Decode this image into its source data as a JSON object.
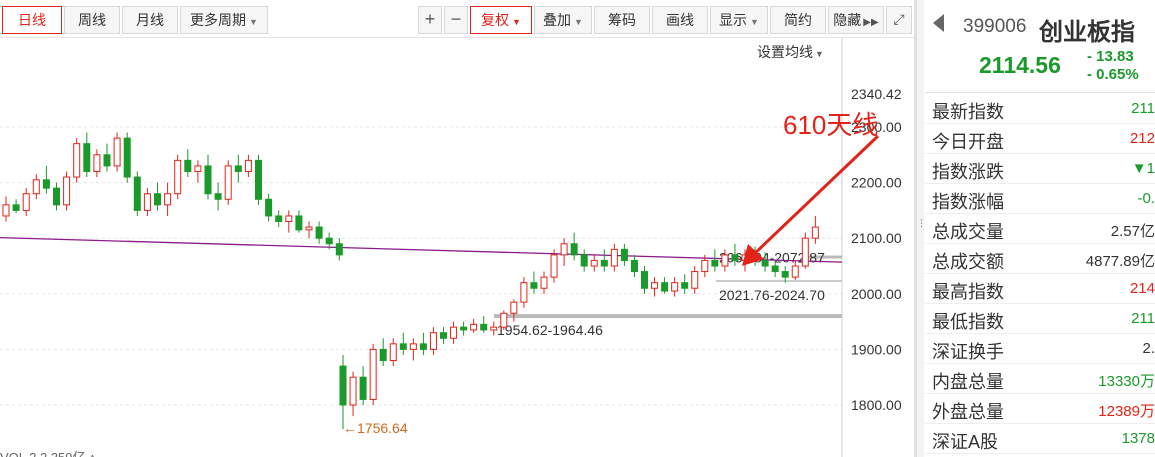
{
  "toolbar": {
    "periods": [
      "日线",
      "周线",
      "月线",
      "更多周期"
    ],
    "zoom_in": "+",
    "zoom_out": "−",
    "adjust": "复权",
    "overlay": "叠加",
    "chips": "筹码",
    "draw": "画线",
    "display": "显示",
    "simple": "简约",
    "hide": "隐藏",
    "expand_icon": "double-chevron-right-icon",
    "fullscreen_icon": "fullscreen-icon"
  },
  "chart": {
    "ma_setting": "设置均线",
    "annotation": "610天线",
    "y_axis": {
      "top_value": "2340.42",
      "ticks": [
        "2300.00",
        "2200.00",
        "2100.00",
        "2000.00",
        "1900.00",
        "1800.00"
      ]
    },
    "low_marker": "←1756.64",
    "ranges": [
      {
        "label": "1954.62-1964.46"
      },
      {
        "label": "2021.76-2024.70"
      },
      {
        "label": "2061.84-2072.87"
      }
    ],
    "bottom_text": "VOL 2 2 359亿 ↑"
  },
  "chart_data": {
    "type": "candlestick",
    "ylim": [
      1740,
      2360
    ],
    "annotations": [
      "610天线",
      "1756.64",
      "1954.62-1964.46",
      "2021.76-2024.70",
      "2061.84-2072.87"
    ],
    "candles": [
      [
        2140,
        2175,
        2130,
        2160
      ],
      [
        2160,
        2170,
        2145,
        2150
      ],
      [
        2150,
        2190,
        2140,
        2180
      ],
      [
        2180,
        2215,
        2170,
        2205
      ],
      [
        2205,
        2230,
        2180,
        2190
      ],
      [
        2190,
        2200,
        2150,
        2160
      ],
      [
        2160,
        2220,
        2150,
        2210
      ],
      [
        2210,
        2280,
        2200,
        2270
      ],
      [
        2270,
        2290,
        2210,
        2220
      ],
      [
        2220,
        2260,
        2210,
        2250
      ],
      [
        2250,
        2270,
        2220,
        2230
      ],
      [
        2230,
        2290,
        2220,
        2280
      ],
      [
        2280,
        2290,
        2200,
        2210
      ],
      [
        2210,
        2220,
        2140,
        2150
      ],
      [
        2150,
        2190,
        2140,
        2180
      ],
      [
        2180,
        2200,
        2150,
        2160
      ],
      [
        2160,
        2200,
        2140,
        2180
      ],
      [
        2180,
        2250,
        2170,
        2240
      ],
      [
        2240,
        2260,
        2210,
        2220
      ],
      [
        2220,
        2240,
        2200,
        2230
      ],
      [
        2230,
        2250,
        2170,
        2180
      ],
      [
        2180,
        2200,
        2150,
        2170
      ],
      [
        2170,
        2240,
        2160,
        2230
      ],
      [
        2230,
        2250,
        2200,
        2220
      ],
      [
        2220,
        2250,
        2210,
        2240
      ],
      [
        2240,
        2250,
        2160,
        2170
      ],
      [
        2170,
        2180,
        2130,
        2140
      ],
      [
        2140,
        2150,
        2120,
        2130
      ],
      [
        2130,
        2150,
        2110,
        2140
      ],
      [
        2140,
        2150,
        2110,
        2115
      ],
      [
        2115,
        2130,
        2100,
        2120
      ],
      [
        2120,
        2130,
        2090,
        2100
      ],
      [
        2100,
        2110,
        2080,
        2090
      ],
      [
        2090,
        2100,
        2060,
        2070
      ],
      [
        1870,
        1890,
        1756.64,
        1800
      ],
      [
        1800,
        1860,
        1780,
        1850
      ],
      [
        1850,
        1870,
        1800,
        1810
      ],
      [
        1810,
        1910,
        1800,
        1900
      ],
      [
        1900,
        1920,
        1870,
        1880
      ],
      [
        1880,
        1920,
        1870,
        1910
      ],
      [
        1910,
        1930,
        1890,
        1900
      ],
      [
        1900,
        1920,
        1880,
        1910
      ],
      [
        1910,
        1930,
        1890,
        1900
      ],
      [
        1900,
        1940,
        1890,
        1930
      ],
      [
        1930,
        1940,
        1910,
        1920
      ],
      [
        1920,
        1950,
        1910,
        1940
      ],
      [
        1940,
        1950,
        1925,
        1935
      ],
      [
        1935,
        1955,
        1930,
        1945
      ],
      [
        1945,
        1960,
        1930,
        1935
      ],
      [
        1935,
        1950,
        1925,
        1940
      ],
      [
        1940,
        1970,
        1935,
        1965
      ],
      [
        1965,
        1990,
        1950,
        1985
      ],
      [
        1985,
        2030,
        1975,
        2020
      ],
      [
        2020,
        2040,
        2000,
        2010
      ],
      [
        2010,
        2040,
        2000,
        2030
      ],
      [
        2030,
        2080,
        2020,
        2070
      ],
      [
        2070,
        2100,
        2050,
        2090
      ],
      [
        2090,
        2110,
        2060,
        2070
      ],
      [
        2070,
        2080,
        2040,
        2050
      ],
      [
        2050,
        2070,
        2040,
        2060
      ],
      [
        2060,
        2080,
        2040,
        2050
      ],
      [
        2050,
        2090,
        2040,
        2080
      ],
      [
        2080,
        2090,
        2050,
        2060
      ],
      [
        2060,
        2070,
        2030,
        2040
      ],
      [
        2040,
        2050,
        2000,
        2010
      ],
      [
        2010,
        2030,
        1995,
        2020
      ],
      [
        2020,
        2030,
        2000,
        2005
      ],
      [
        2005,
        2030,
        1995,
        2020
      ],
      [
        2020,
        2035,
        2000,
        2010
      ],
      [
        2010,
        2050,
        2000,
        2040
      ],
      [
        2040,
        2070,
        2030,
        2060
      ],
      [
        2060,
        2080,
        2040,
        2050
      ],
      [
        2050,
        2080,
        2040,
        2070
      ],
      [
        2070,
        2090,
        2050,
        2060
      ],
      [
        2060,
        2080,
        2040,
        2070
      ],
      [
        2070,
        2085,
        2050,
        2060
      ],
      [
        2060,
        2075,
        2040,
        2050
      ],
      [
        2050,
        2060,
        2030,
        2040
      ],
      [
        2040,
        2050,
        2020,
        2030
      ],
      [
        2030,
        2060,
        2025,
        2050
      ],
      [
        2050,
        2110,
        2045,
        2100
      ],
      [
        2100,
        2140,
        2090,
        2120
      ]
    ]
  },
  "panel": {
    "code": "399006",
    "name": "创业板指",
    "price": "2114.56",
    "change": "- 13.83",
    "change_pct": "- 0.65%",
    "rows": [
      {
        "label": "最新指数",
        "value": "211",
        "color": "green"
      },
      {
        "label": "今日开盘",
        "value": "212",
        "color": "red"
      },
      {
        "label": "指数涨跌",
        "value": "▼1",
        "color": "green"
      },
      {
        "label": "指数涨幅",
        "value": "-0.",
        "color": "green"
      },
      {
        "label": "总成交量",
        "value": "2.57亿",
        "color": "dark"
      },
      {
        "label": "总成交额",
        "value": "4877.89亿",
        "color": "dark"
      },
      {
        "label": "最高指数",
        "value": "214",
        "color": "red"
      },
      {
        "label": "最低指数",
        "value": "211",
        "color": "green"
      },
      {
        "label": "深证换手",
        "value": "2.",
        "color": "dark"
      },
      {
        "label": "内盘总量",
        "value": "13330万",
        "color": "green"
      },
      {
        "label": "外盘总量",
        "value": "12389万",
        "color": "red"
      },
      {
        "label": "深证A股",
        "value": "1378",
        "color": "green"
      }
    ]
  },
  "colors": {
    "up": "#e2231a",
    "down": "#1a9a2a",
    "ma610": "#8b1a8b",
    "support": "#bbbbbb"
  }
}
